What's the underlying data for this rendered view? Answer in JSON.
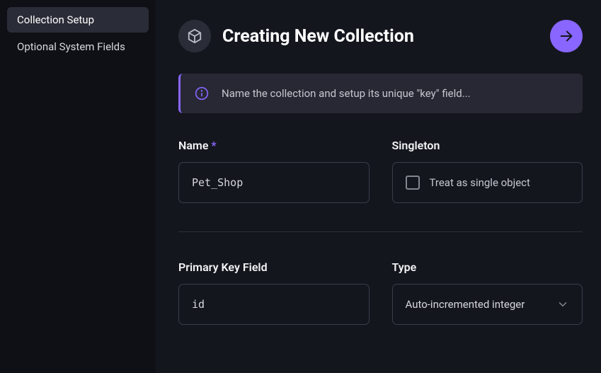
{
  "sidebar": {
    "items": [
      {
        "label": "Collection Setup",
        "active": true
      },
      {
        "label": "Optional System Fields",
        "active": false
      }
    ]
  },
  "header": {
    "title": "Creating New Collection"
  },
  "banner": {
    "text": "Name the collection and setup its unique \"key\" field..."
  },
  "form": {
    "name": {
      "label": "Name",
      "required_mark": "*",
      "value": "Pet_Shop"
    },
    "singleton": {
      "label": "Singleton",
      "checkbox_label": "Treat as single object"
    },
    "primary_key": {
      "label": "Primary Key Field",
      "value": "id"
    },
    "type": {
      "label": "Type",
      "selected": "Auto-incremented integer"
    }
  }
}
